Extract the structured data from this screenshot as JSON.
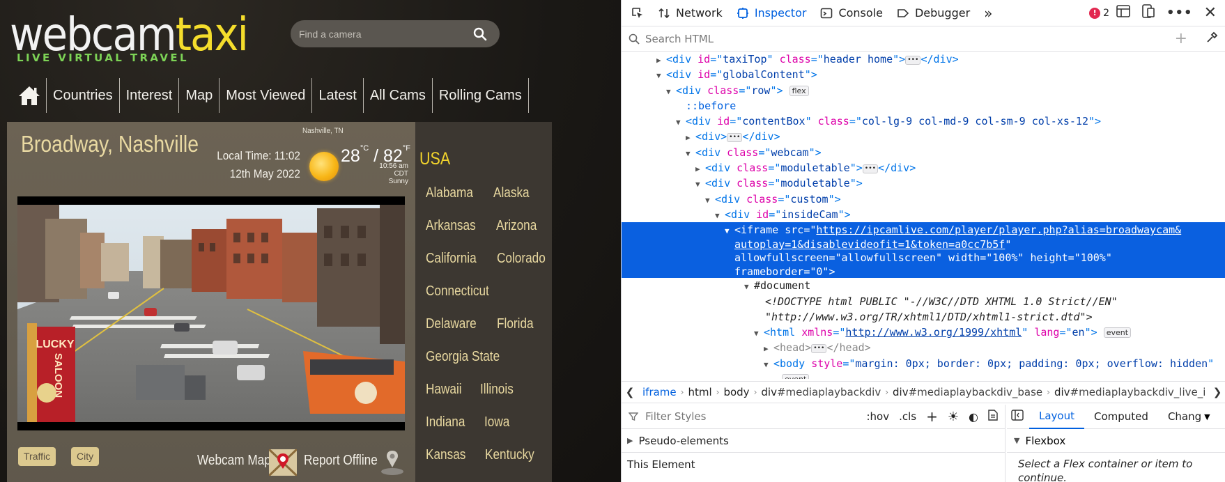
{
  "site": {
    "logo": {
      "part1": "webcam",
      "part2": "taxi"
    },
    "tagline": "LIVE VIRTUAL TRAVEL",
    "search": {
      "placeholder": "Find a camera"
    },
    "nav": [
      "Countries",
      "Interest",
      "Map",
      "Most Viewed",
      "Latest",
      "All Cams",
      "Rolling Cams"
    ],
    "location": "Broadway, Nashville",
    "city_small": "Nashville, TN",
    "local_time": "Local Time: 11:02",
    "date": "12th May 2022",
    "temp_c": "28",
    "temp_c_unit": "°C",
    "temp_sep": "/",
    "temp_f": "82",
    "temp_f_unit": "°F",
    "weather_time": "10:56 am CDT",
    "weather_desc": "Sunny",
    "tags": [
      "Traffic",
      "City"
    ],
    "webcam_map": "Webcam Map",
    "report_offline": "Report Offline",
    "sidebar_title": "USA",
    "states": [
      [
        "Alabama",
        "Alaska"
      ],
      [
        "Arkansas",
        "Arizona"
      ],
      [
        "California",
        "Colorado"
      ],
      [
        "Connecticut"
      ],
      [
        "Delaware",
        "Florida"
      ],
      [
        "Georgia State"
      ],
      [
        "Hawaii",
        "Illinois"
      ],
      [
        "Indiana",
        "Iowa"
      ],
      [
        "Kansas",
        "Kentucky"
      ]
    ],
    "cam_signs": {
      "sign1": "LUCKY",
      "sign2": "SALOON"
    }
  },
  "devtools": {
    "tabs": [
      "Network",
      "Inspector",
      "Console",
      "Debugger"
    ],
    "active_tab": "Inspector",
    "error_count": "2",
    "search_placeholder": "Search HTML",
    "tree": {
      "l0": {
        "tag": "div",
        "attr1": "id",
        "val1": "taxiTop",
        "attr2": "class",
        "val2": "header home"
      },
      "l1": {
        "tag": "div",
        "attr1": "id",
        "val1": "globalContent"
      },
      "l2": {
        "tag": "div",
        "attr1": "class",
        "val1": "row",
        "badge": "flex"
      },
      "l3": {
        "pseudo": "::before"
      },
      "l4": {
        "tag": "div",
        "attr1": "id",
        "val1": "contentBox",
        "attr2": "class",
        "val2": "col-lg-9 col-md-9 col-sm-9 col-xs-12"
      },
      "l5": {
        "tag": "div"
      },
      "l6": {
        "tag": "div",
        "attr1": "class",
        "val1": "webcam"
      },
      "l7": {
        "tag": "div",
        "attr1": "class",
        "val1": "moduletable"
      },
      "l8": {
        "tag": "div",
        "attr1": "class",
        "val1": "moduletable"
      },
      "l9": {
        "tag": "div",
        "attr1": "class",
        "val1": "custom"
      },
      "l10": {
        "tag": "div",
        "attr1": "id",
        "val1": "insideCam"
      },
      "iframe": {
        "tag": "iframe",
        "src_attr": "src",
        "src_line1": "https://ipcamlive.com/player/player.php?alias=broadwaycam&",
        "src_line2": "autoplay=1&disablevideofit=1&token=a0cc7b5f",
        "line3": "allowfullscreen=\"allowfullscreen\" width=\"100%\" height=\"100%\"",
        "line4": "frameborder=\"0\">"
      },
      "doc": "#document",
      "doctype1": "<!DOCTYPE html PUBLIC \"-//W3C//DTD XHTML 1.0 Strict//EN\"",
      "doctype2": "\"http://www.w3.org/TR/xhtml1/DTD/xhtml1-strict.dtd\">",
      "html": {
        "tag": "html",
        "attr1": "xmlns",
        "val1": "http://www.w3.org/1999/xhtml",
        "attr2": "lang",
        "val2": "en",
        "badge": "event"
      },
      "head": {
        "tag": "head"
      },
      "body": {
        "tag": "body",
        "attr1": "style",
        "val1": "margin: 0px; border: 0px; padding: 0px; overflow: hidden",
        "badge": "event"
      }
    },
    "breadcrumbs": [
      {
        "tag": "iframe",
        "id": ""
      },
      {
        "tag": "html",
        "id": ""
      },
      {
        "tag": "body",
        "id": ""
      },
      {
        "tag": "div",
        "id": "#mediaplaybackdiv"
      },
      {
        "tag": "div",
        "id": "#mediaplaybackdiv_base"
      },
      {
        "tag": "div",
        "id": "#mediaplaybackdiv_live_i"
      }
    ],
    "styles": {
      "filter_placeholder": "Filter Styles",
      "hov": ":hov",
      "cls": ".cls",
      "pseudo_elements": "Pseudo-elements",
      "this_element": "This Element"
    },
    "layout": {
      "tabs": [
        "Layout",
        "Computed",
        "Chang"
      ],
      "active_tab": "Layout",
      "flexbox": "Flexbox",
      "flex_hint": "Select a Flex container or item to continue."
    }
  }
}
